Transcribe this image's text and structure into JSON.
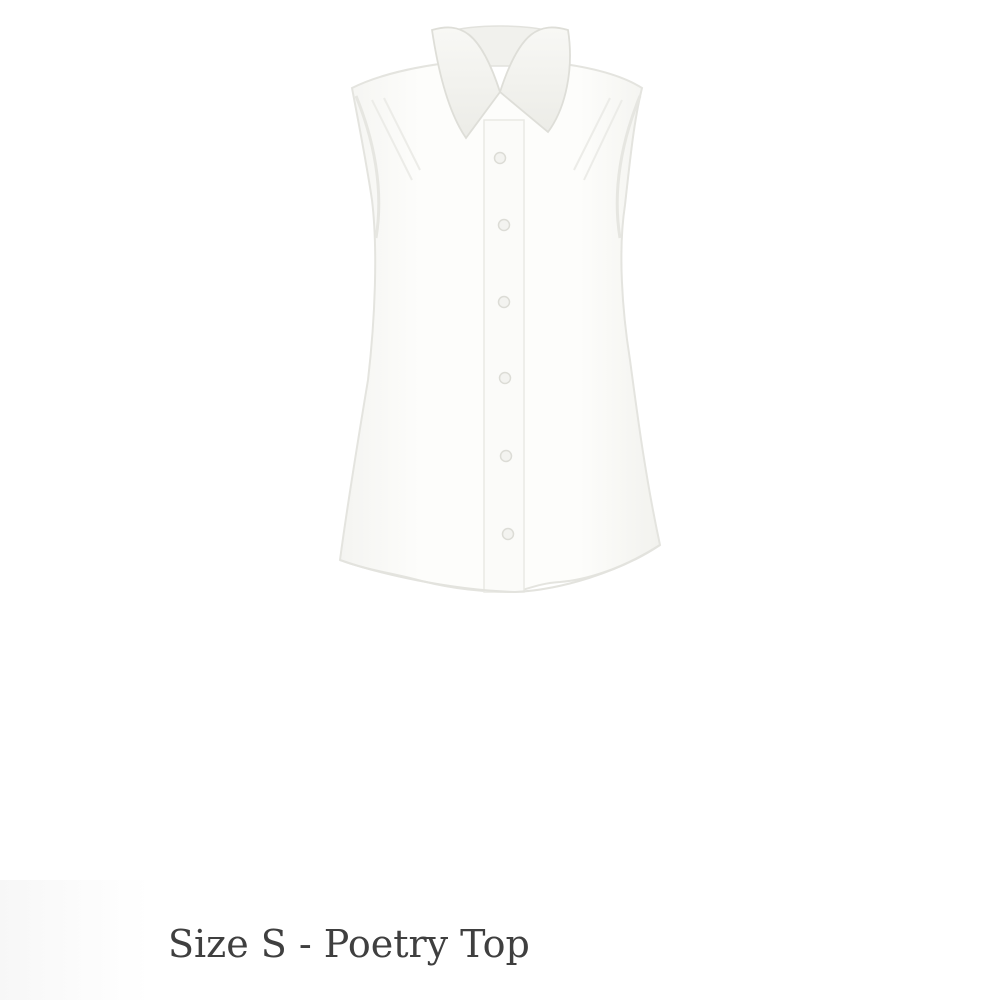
{
  "product": {
    "title": "Size S - Poetry Top",
    "image_subject": "shirt-icon",
    "colors": {
      "background": "#ffffff",
      "fabric": "#fbfbf9",
      "fabric_shadow": "#eeeeea",
      "title_text": "#3f3f3f"
    }
  }
}
